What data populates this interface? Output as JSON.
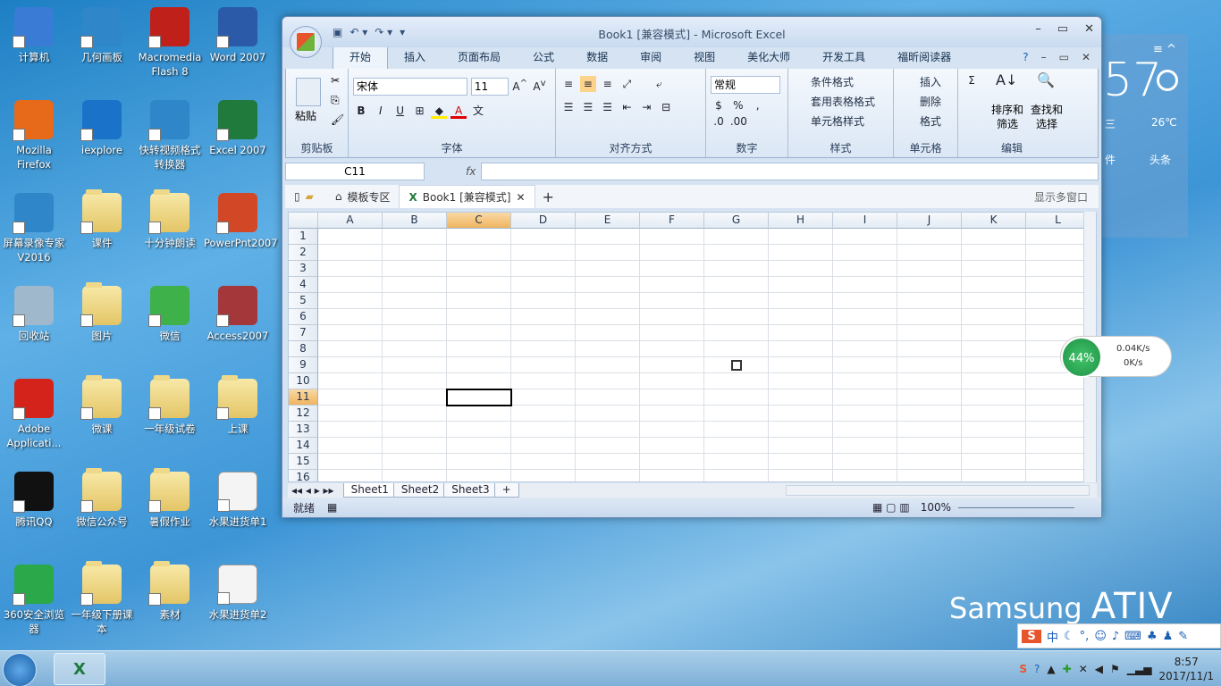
{
  "desktop": {
    "icons": [
      {
        "label": "计算机",
        "kind": "computer"
      },
      {
        "label": "几何画板",
        "kind": "app"
      },
      {
        "label": "Macromedia Flash 8",
        "kind": "flash"
      },
      {
        "label": "Word 2007",
        "kind": "word"
      },
      {
        "label": "Mozilla Firefox",
        "kind": "firefox"
      },
      {
        "label": "iexplore",
        "kind": "ie"
      },
      {
        "label": "快转视频格式转换器",
        "kind": "app"
      },
      {
        "label": "Excel 2007",
        "kind": "excel"
      },
      {
        "label": "屏幕录像专家V2016",
        "kind": "app"
      },
      {
        "label": "课件",
        "kind": "folder"
      },
      {
        "label": "十分钟朗读",
        "kind": "folder"
      },
      {
        "label": "PowerPnt2007",
        "kind": "ppt"
      },
      {
        "label": "回收站",
        "kind": "recycle"
      },
      {
        "label": "图片",
        "kind": "folder"
      },
      {
        "label": "微信",
        "kind": "wechat"
      },
      {
        "label": "Access2007",
        "kind": "access"
      },
      {
        "label": "Adobe Applicati...",
        "kind": "adobe"
      },
      {
        "label": "微课",
        "kind": "folder"
      },
      {
        "label": "一年级试卷",
        "kind": "folder"
      },
      {
        "label": "上课",
        "kind": "folder"
      },
      {
        "label": "腾讯QQ",
        "kind": "qq"
      },
      {
        "label": "微信公众号",
        "kind": "folder"
      },
      {
        "label": "暑假作业",
        "kind": "folder"
      },
      {
        "label": "水果进货单1",
        "kind": "file"
      },
      {
        "label": "360安全浏览器",
        "kind": "browser360"
      },
      {
        "label": "一年级下册课本",
        "kind": "folder"
      },
      {
        "label": "素材",
        "kind": "folder"
      },
      {
        "label": "水果进货单2",
        "kind": "file"
      }
    ],
    "brand": {
      "name": "Samsung",
      "model": "ATIV"
    },
    "weather": {
      "temp": "57",
      "desc": "三",
      "low": "26℃",
      "item1": "件",
      "item2": "头条"
    },
    "netmon": {
      "percent": "44%",
      "up": "0.04K/s",
      "down": "0K/s"
    },
    "ime": {
      "mode": "中"
    }
  },
  "excel": {
    "title": "Book1  [兼容模式] - Microsoft Excel",
    "tabs": [
      "开始",
      "插入",
      "页面布局",
      "公式",
      "数据",
      "审阅",
      "视图",
      "美化大师",
      "开发工具",
      "福昕阅读器"
    ],
    "ribbon": {
      "paste": "粘贴",
      "clipboard": "剪贴板",
      "font_name": "宋体",
      "font_size": "11",
      "font": "字体",
      "align": "对齐方式",
      "number_format": "常规",
      "number": "数字",
      "cond_format": "条件格式",
      "table_format": "套用表格格式",
      "cell_style": "单元格样式",
      "styles": "样式",
      "insert": "插入",
      "delete": "删除",
      "format": "格式",
      "cells": "单元格",
      "sort": "排序和筛选",
      "find": "查找和选择",
      "editing": "编辑"
    },
    "name_box": "C11",
    "fx": "fx",
    "doc_tabs": {
      "template": "模板专区",
      "book": "Book1  [兼容模式]",
      "multi": "显示多窗口"
    },
    "columns": [
      "A",
      "B",
      "C",
      "D",
      "E",
      "F",
      "G",
      "H",
      "I",
      "J",
      "K",
      "L"
    ],
    "rows": [
      "1",
      "2",
      "3",
      "4",
      "5",
      "6",
      "7",
      "8",
      "9",
      "10",
      "11",
      "12",
      "13",
      "14",
      "15",
      "16"
    ],
    "sheets": [
      "Sheet1",
      "Sheet2",
      "Sheet3"
    ],
    "status": "就绪",
    "zoom": "100%"
  },
  "taskbar": {
    "time": "8:57",
    "date": "2017/11/1"
  }
}
